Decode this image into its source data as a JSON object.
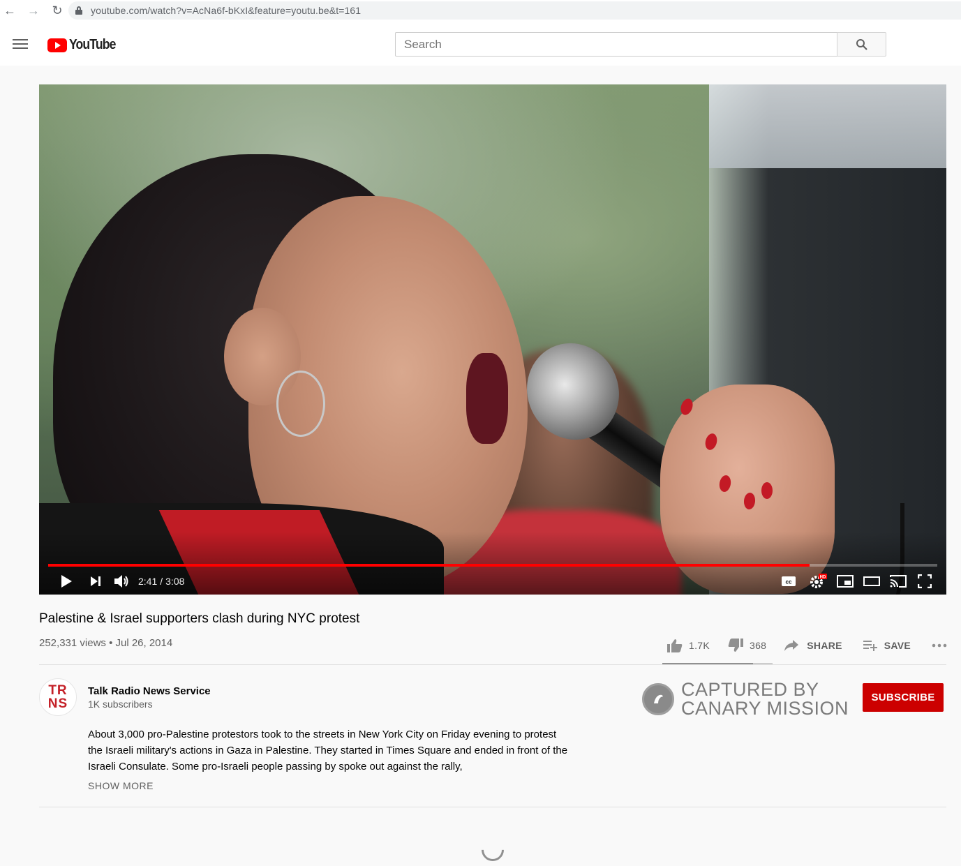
{
  "browser": {
    "url": "youtube.com/watch?v=AcNa6f-bKxI&feature=youtu.be&t=161"
  },
  "header": {
    "logo_text": "YouTube",
    "search_placeholder": "Search"
  },
  "player": {
    "current_time": "2:41",
    "separator": "/",
    "duration": "3:08",
    "progress_fraction": 0.856
  },
  "video": {
    "title": "Palestine & Israel supporters clash during NYC protest",
    "meta": "252,331 views • Jul 26, 2014",
    "likes": "1.7K",
    "dislikes": "368",
    "share_label": "SHARE",
    "save_label": "SAVE",
    "like_fraction": 0.82
  },
  "channel": {
    "avatar_line1": "TR",
    "avatar_line2": "NS",
    "name": "Talk Radio News Service",
    "subscribers": "1K subscribers",
    "subscribe_label": "SUBSCRIBE"
  },
  "watermark": {
    "line1": "CAPTURED BY",
    "line2": "CANARY MISSION"
  },
  "description": {
    "text": "About 3,000 pro-Palestine protestors took to the streets in New York City on Friday evening to protest the Israeli military's actions in Gaza in Palestine. They started in Times Square and ended in front of the Israeli Consulate. Some pro-Israeli people passing by spoke out against the rally,",
    "show_more": "SHOW MORE"
  },
  "colors": {
    "brand_red": "#ff0000",
    "subscribe_red": "#cc0000",
    "background": "#f9f9f9"
  }
}
